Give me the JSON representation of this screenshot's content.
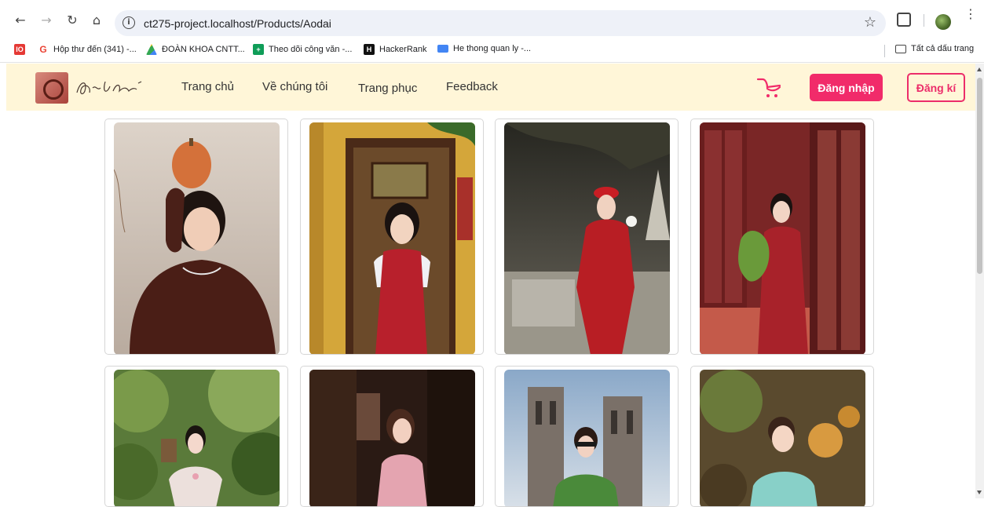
{
  "browser": {
    "url": "ct275-project.localhost/Products/Aodai",
    "icons": [
      "back-icon",
      "forward-icon",
      "reload-icon",
      "home-icon",
      "site-info-icon",
      "bookmark-star-icon",
      "extensions-icon",
      "profile-avatar",
      "menu-icon"
    ]
  },
  "bookmarks": {
    "items": [
      {
        "label": "Hộp thư đến (341) -...",
        "icon": "gmail-icon",
        "color": "#ea4335"
      },
      {
        "label": "ĐOÀN KHOA CNTT...",
        "icon": "drive-icon",
        "color": "#1e88e5"
      },
      {
        "label": "Theo dõi công văn -...",
        "icon": "sheets-icon",
        "color": "#0f9d58"
      },
      {
        "label": "HackerRank",
        "icon": "hackerrank-icon",
        "color": "#111111"
      },
      {
        "label": "He thong quan ly -...",
        "icon": "system-icon",
        "color": "#4285f4"
      }
    ],
    "all_bookmarks": "Tất cả dấu trang"
  },
  "header": {
    "nav": [
      "Trang chủ",
      "Về chúng tôi",
      "Trang phục",
      "Feedback"
    ],
    "login": "Đăng nhập",
    "register": "Đăng kí",
    "accent": "#f12b6a",
    "background": "#fff6d8"
  },
  "products": [
    {
      "name": "product-1",
      "palette": [
        "#d9cfc5",
        "#b3a59b",
        "#5a2a20",
        "#3a1812"
      ]
    },
    {
      "name": "product-2",
      "palette": [
        "#d4a63a",
        "#6b4a2a",
        "#b8202c",
        "#3a2818"
      ]
    },
    {
      "name": "product-3",
      "palette": [
        "#3a3a32",
        "#7a756a",
        "#b81e24",
        "#2a2622"
      ]
    },
    {
      "name": "product-4",
      "palette": [
        "#8a2a2a",
        "#5a1e1e",
        "#a8222a",
        "#c85a4a"
      ]
    },
    {
      "name": "product-5",
      "palette": [
        "#5a7a3a",
        "#9ab86a",
        "#e8dcd8",
        "#3a5a22"
      ]
    },
    {
      "name": "product-6",
      "palette": [
        "#2a1a14",
        "#6a4a3a",
        "#e4a4b0",
        "#3a2a22"
      ]
    },
    {
      "name": "product-7",
      "palette": [
        "#a8b8c8",
        "#8a8078",
        "#4a8a3a",
        "#6a6a6a"
      ]
    },
    {
      "name": "product-8",
      "palette": [
        "#6a5a3a",
        "#c8a060",
        "#88d0c8",
        "#4a3a22"
      ]
    }
  ]
}
